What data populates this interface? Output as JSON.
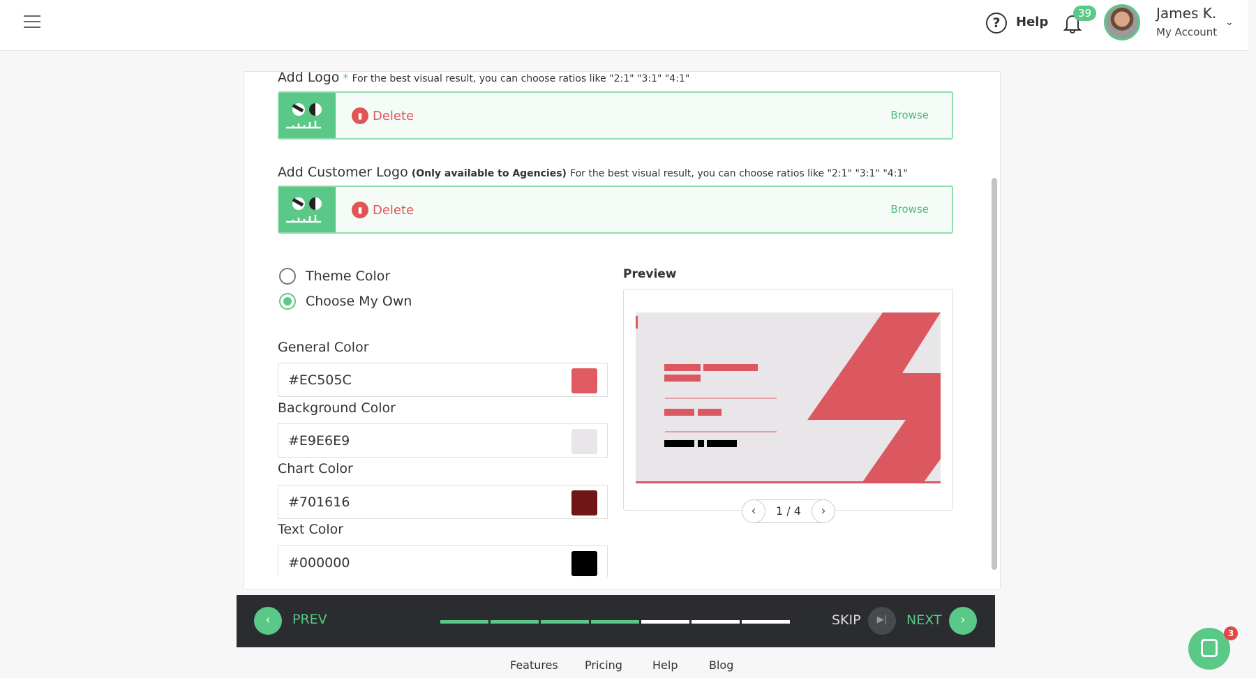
{
  "header": {
    "help": "Help",
    "notifications": "39",
    "user_name": "James K.",
    "account": "My Account"
  },
  "logo": {
    "title": "Add Logo",
    "required": "*",
    "note": "For the best visual result, you can choose ratios like \"2:1\" \"3:1\" \"4:1\"",
    "delete": "Delete",
    "browse": "Browse"
  },
  "customer_logo": {
    "title": "Add Customer Logo",
    "qualifier": "(Only available to Agencies)",
    "note": "For the best visual result, you can choose ratios like \"2:1\" \"3:1\" \"4:1\"",
    "delete": "Delete",
    "browse": "Browse"
  },
  "color_mode": {
    "options": [
      "Theme Color",
      "Choose My Own"
    ],
    "selected": "Choose My Own"
  },
  "colors": [
    {
      "label": "General Color",
      "value": "#EC505C",
      "swatch": "#e05a62"
    },
    {
      "label": "Background Color",
      "value": "#E9E6E9",
      "swatch": "#e9e6e9"
    },
    {
      "label": "Chart Color",
      "value": "#701616",
      "swatch": "#701616"
    },
    {
      "label": "Text Color",
      "value": "#000000",
      "swatch": "#000000"
    }
  ],
  "preview": {
    "title": "Preview",
    "page": "1 / 4",
    "accent": "#db5860",
    "background": "#e9e6e9"
  },
  "wizard": {
    "prev": "PREV",
    "skip": "SKIP",
    "next": "NEXT",
    "steps_total": 7,
    "steps_done": 4,
    "accent": "#5ac887"
  },
  "footer": {
    "links": [
      "Features",
      "Pricing",
      "Help",
      "Blog"
    ]
  },
  "chat": {
    "badge": "3"
  }
}
